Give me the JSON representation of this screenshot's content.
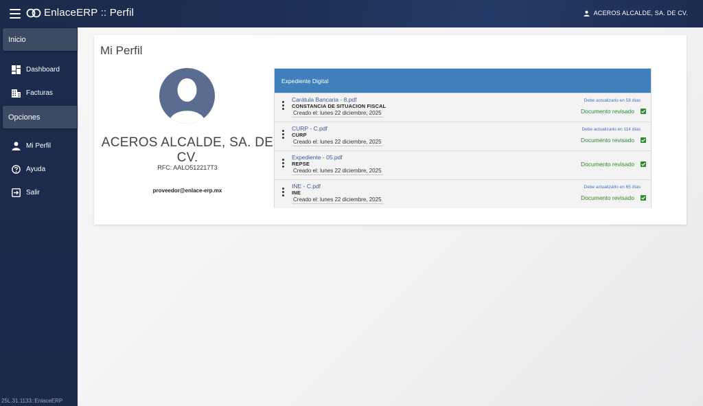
{
  "app": {
    "title": "EnlaceERP :: Perfil",
    "user": "ACEROS ALCALDE, SA. DE CV.",
    "version": "25L.31.1133::EnlaceERP"
  },
  "sidebar": {
    "sections": [
      {
        "label": "Inicio",
        "items": [
          {
            "label": "Dashboard",
            "icon": "dashboard-icon"
          },
          {
            "label": "Facturas",
            "icon": "building-icon"
          }
        ]
      },
      {
        "label": "Opciones",
        "items": [
          {
            "label": "Mi Perfil",
            "icon": "person-icon"
          },
          {
            "label": "Ayuda",
            "icon": "help-icon"
          },
          {
            "label": "Salir",
            "icon": "logout-icon"
          }
        ]
      }
    ]
  },
  "profile": {
    "page_title": "Mi Perfil",
    "company_name": "ACEROS ALCALDE, SA. DE CV.",
    "rfc": "RFC: AALO512217T3",
    "email": "proveedor@enlace-erp.mx"
  },
  "expediente": {
    "header": "Expediente Digital",
    "documents": [
      {
        "file": "Carátula Bancaria - 8.pdf",
        "type": "CONSTANCIA DE SITUACION FISCAL",
        "created": "Creado el: lunes 22 diciembre, 2025",
        "due": "Debe actualizarlo en 58 días",
        "status": "Documento revisado"
      },
      {
        "file": "CURP - C.pdf",
        "type": "CURP",
        "created": "Creado el: lunes 22 diciembre, 2025",
        "due": "Debe actualizarlo en 114 días",
        "status": "Documento revisado"
      },
      {
        "file": "Expediente - 05.pdf",
        "type": "REPSE",
        "created": "Creado el: lunes 22 diciembre, 2025",
        "due": "",
        "status": "Documento revisado"
      },
      {
        "file": "INE - C.pdf",
        "type": "INE",
        "created": "Creado el: lunes 22 diciembre, 2025",
        "due": "Debe actualizarlo en 65 días",
        "status": "Documento revisado"
      }
    ]
  },
  "colors": {
    "sidebar": "#1b2a4b",
    "panel_header": "#4080bd",
    "status_green": "#2e8b2e",
    "due_blue": "#3a74c0"
  }
}
